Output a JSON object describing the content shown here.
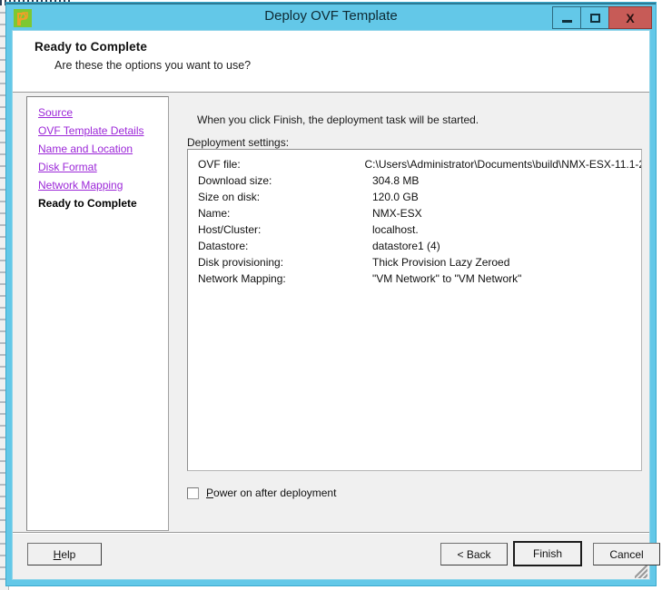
{
  "window": {
    "title": "Deploy OVF Template",
    "icon": "vmware-ovf-icon",
    "controls": {
      "minimize": "minimize-icon",
      "maximize": "maximize-icon",
      "close": "X"
    }
  },
  "header": {
    "title": "Ready to Complete",
    "subtitle": "Are these the options you want to use?"
  },
  "sidebar": {
    "items": [
      {
        "label": "Source",
        "current": false
      },
      {
        "label": "OVF Template Details",
        "current": false
      },
      {
        "label": "Name and Location",
        "current": false
      },
      {
        "label": "Disk Format",
        "current": false
      },
      {
        "label": "Network Mapping",
        "current": false
      },
      {
        "label": "Ready to Complete",
        "current": true
      }
    ]
  },
  "main": {
    "intro": "When you click Finish, the deployment task will be started.",
    "settings_caption": "Deployment settings:",
    "settings": [
      {
        "label": "OVF file:",
        "value": "C:\\Users\\Administrator\\Documents\\build\\NMX-ESX-11.1-2..."
      },
      {
        "label": "Download size:",
        "value": "304.8 MB"
      },
      {
        "label": "Size on disk:",
        "value": "120.0 GB"
      },
      {
        "label": "Name:",
        "value": "NMX-ESX"
      },
      {
        "label": "Host/Cluster:",
        "value": "localhost."
      },
      {
        "label": "Datastore:",
        "value": "datastore1 (4)"
      },
      {
        "label": "Disk provisioning:",
        "value": "Thick Provision Lazy Zeroed"
      },
      {
        "label": "Network Mapping:",
        "value": "\"VM Network\" to \"VM Network\""
      }
    ],
    "power_on": {
      "label_accel": "P",
      "label_rest": "ower on after deployment",
      "checked": false
    }
  },
  "footer": {
    "help_label": "Help",
    "help_accel": "H",
    "back_label": "< Back",
    "finish_label": "Finish",
    "cancel_label": "Cancel"
  },
  "colors": {
    "title_bar": "#63c8e8",
    "close_button": "#c75b57",
    "link": "#9c27d8",
    "panel": "#f0f0f0"
  }
}
